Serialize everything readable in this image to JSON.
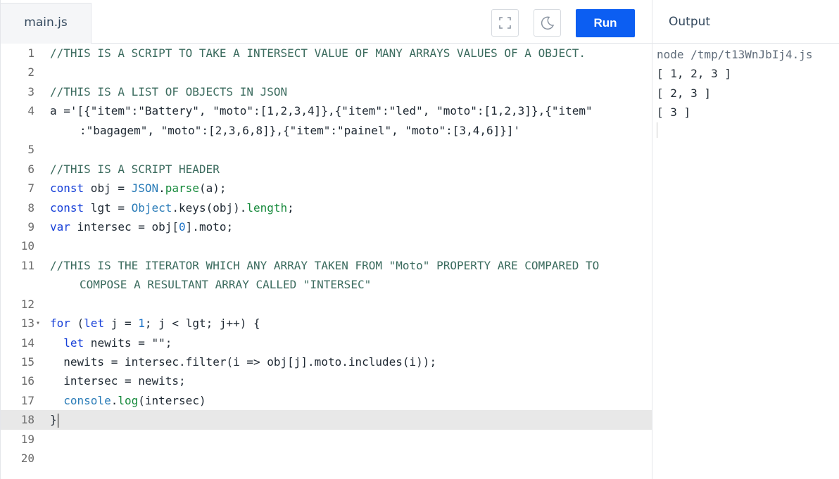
{
  "editor": {
    "tab_label": "main.js",
    "fullscreen_icon": "fullscreen-icon",
    "theme_icon": "moon-icon",
    "run_label": "Run",
    "accent": "#0c5ef2"
  },
  "code": {
    "active_line": 18,
    "lines": [
      {
        "n": "1",
        "t": "//THIS IS A SCRIPT TO TAKE A INTERSECT VALUE OF MANY ARRAYS VALUES OF A OBJECT."
      },
      {
        "n": "2",
        "t": ""
      },
      {
        "n": "3",
        "t": "//THIS IS A LIST OF OBJECTS IN JSON"
      },
      {
        "n": "4",
        "t": "a ='[{\"item\":\"Battery\", \"moto\":[1,2,3,4]},{\"item\":\"led\", \"moto\":[1,2,3]},{\"item\""
      },
      {
        "n": "",
        "t": ":\"bagagem\", \"moto\":[2,3,6,8]},{\"item\":\"painel\", \"moto\":[3,4,6]}]'"
      },
      {
        "n": "5",
        "t": ""
      },
      {
        "n": "6",
        "t": "//THIS IS A SCRIPT HEADER"
      },
      {
        "n": "7",
        "t": "const obj = JSON.parse(a);"
      },
      {
        "n": "8",
        "t": "const lgt = Object.keys(obj).length;"
      },
      {
        "n": "9",
        "t": "var intersec = obj[0].moto;"
      },
      {
        "n": "10",
        "t": ""
      },
      {
        "n": "11",
        "t": "//THIS IS THE ITERATOR WHICH ANY ARRAY TAKEN FROM \"Moto\" PROPERTY ARE COMPARED TO"
      },
      {
        "n": "",
        "t": "COMPOSE A RESULTANT ARRAY CALLED \"INTERSEC\""
      },
      {
        "n": "12",
        "t": ""
      },
      {
        "n": "13",
        "t": "for (let j = 1; j < lgt; j++) {"
      },
      {
        "n": "14",
        "t": "  let newits = \"\";"
      },
      {
        "n": "15",
        "t": "  newits = intersec.filter(i => obj[j].moto.includes(i));"
      },
      {
        "n": "16",
        "t": "  intersec = newits;"
      },
      {
        "n": "17",
        "t": "  console.log(intersec)"
      },
      {
        "n": "18",
        "t": "}"
      },
      {
        "n": "19",
        "t": ""
      },
      {
        "n": "20",
        "t": ""
      }
    ]
  },
  "output": {
    "header": "Output",
    "command": "node /tmp/t13WnJbIj4.js",
    "lines": [
      "[ 1, 2, 3 ]",
      "[ 2, 3 ]",
      "[ 3 ]"
    ]
  }
}
